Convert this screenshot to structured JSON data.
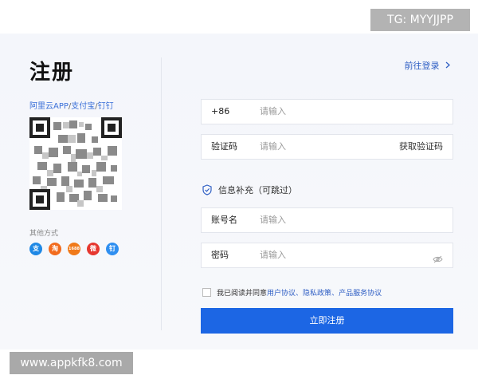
{
  "watermarks": {
    "top_right": "TG: MYYJJPP",
    "bottom_left": "www.appkfk8.com"
  },
  "page": {
    "title": "注册",
    "go_login": "前往登录"
  },
  "scan": {
    "apps": [
      "阿里云APP",
      "支付宝",
      "钉钉"
    ],
    "separator": "/"
  },
  "other": {
    "label": "其他方式",
    "icons": [
      {
        "name": "alipay-icon",
        "glyph": "支",
        "color": "#1e88e5"
      },
      {
        "name": "taobao-icon",
        "glyph": "淘",
        "color": "#f26b1d"
      },
      {
        "name": "1688-icon",
        "glyph": "1688",
        "color": "#f07a1a"
      },
      {
        "name": "weibo-icon",
        "glyph": "微",
        "color": "#e6372f"
      },
      {
        "name": "dingtalk-icon",
        "glyph": "钉",
        "color": "#2f8ff0"
      }
    ]
  },
  "form": {
    "phone": {
      "prefix": "+86",
      "placeholder": "请输入"
    },
    "code": {
      "label": "验证码",
      "placeholder": "请输入",
      "action": "获取验证码"
    },
    "info_header": "信息补充（可跳过）",
    "account": {
      "label": "账号名",
      "placeholder": "请输入"
    },
    "password": {
      "label": "密码",
      "placeholder": "请输入"
    },
    "agreement": {
      "prefix": "我已阅读并同意",
      "link1": "用户协议",
      "sep1": "、",
      "link2": "隐私政策",
      "sep2": "、",
      "link3": "产品服务协议"
    },
    "submit": "立即注册"
  },
  "colors": {
    "accent": "#1c66e4",
    "link": "#2f5fc4"
  }
}
